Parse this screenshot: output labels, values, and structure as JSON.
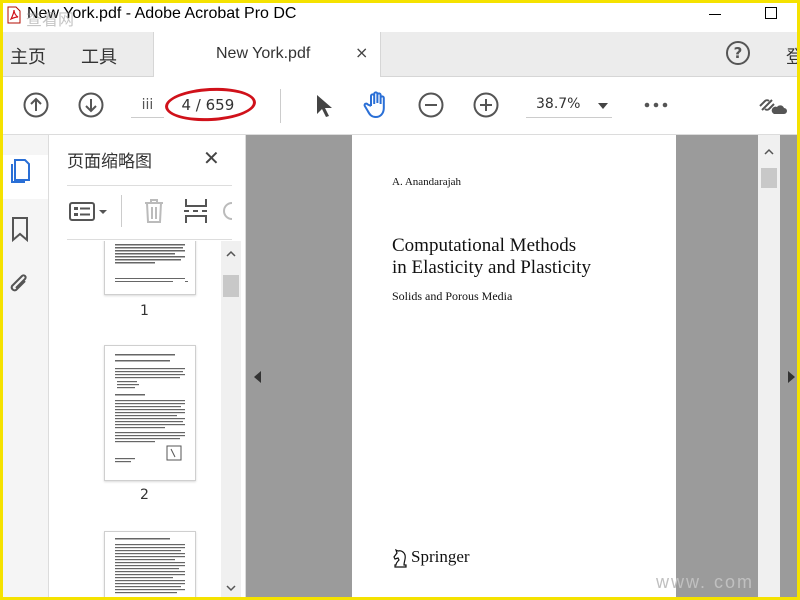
{
  "window": {
    "title": "New York.pdf - Adobe Acrobat Pro DC"
  },
  "menu": {
    "home": "主页",
    "tools": "工具",
    "login": "登"
  },
  "tab": {
    "label": "New York.pdf",
    "close": "×"
  },
  "help": {
    "label": "?"
  },
  "toolbar": {
    "page_label": "iii",
    "current_page": "4",
    "page_separator": "/",
    "total_pages": "659",
    "zoom": "38.7%"
  },
  "thumbnail_panel": {
    "title": "页面缩略图",
    "close": "✕",
    "thumbnails": [
      {
        "label": "1"
      },
      {
        "label": "2"
      },
      {
        "label": ""
      }
    ]
  },
  "document_page": {
    "author": "A. Anandarajah",
    "title_line1": "Computational Methods",
    "title_line2": "in Elasticity and Plasticity",
    "subtitle": "Solids and Porous Media",
    "publisher": "Springer"
  },
  "colors": {
    "accent_blue": "#2a6fd6",
    "highlight_red": "#d0111a",
    "frame_yellow": "#f5e200"
  },
  "icons": {
    "prev_page": "arrow-up-circle-icon",
    "next_page": "arrow-down-circle-icon",
    "select_tool": "cursor-arrow-icon",
    "hand_tool": "hand-icon",
    "zoom_out": "minus-circle-icon",
    "zoom_in": "plus-circle-icon",
    "more": "ellipsis-icon",
    "share": "cloud-link-icon"
  },
  "watermark": {
    "bottom": "www.    com",
    "top": "查看网"
  }
}
